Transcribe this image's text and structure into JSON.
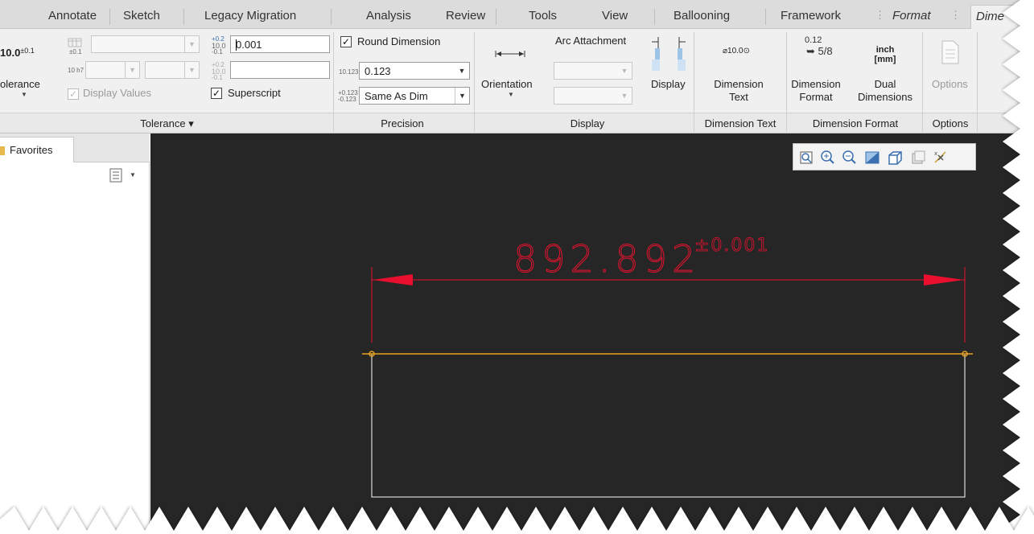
{
  "tabs": [
    "Annotate",
    "Sketch",
    "Legacy Migration",
    "Analysis",
    "Review",
    "Tools",
    "View",
    "Ballooning",
    "Framework",
    "Format",
    "Dime"
  ],
  "tolerance": {
    "tol_icon_text": "10.0",
    "tol_icon_sub": "±0.1",
    "tolerance_label": "olerance",
    "display_values_label": "Display Values",
    "upper_value": "0.001",
    "superscript_label": "Superscript",
    "group_label": "Tolerance ▾",
    "mini_labels": [
      "±0.1",
      "10 h7",
      "+0.2",
      "10.0",
      "-0.1"
    ]
  },
  "precision": {
    "round_dimension_label": "Round Dimension",
    "decimal_value": "0.123",
    "tolerance_decimal_value": "Same As Dim",
    "icon_decimal": "10.123",
    "icon_tol_upper": "+0.123",
    "icon_tol_lower": "-0.123",
    "group_label": "Precision"
  },
  "display": {
    "orientation_label": "Orientation",
    "arc_attachment_label": "Arc Attachment",
    "display_label": "Display",
    "group_label": "Display"
  },
  "dimension_text": {
    "icon_text": "⌀10.0⊙",
    "label_line1": "Dimension",
    "label_line2": "Text",
    "group_label": "Dimension Text"
  },
  "dimension_format": {
    "icon_decimal": "0.12",
    "icon_fraction": "5/8",
    "format_label_line1": "Dimension",
    "format_label_line2": "Format",
    "dual_icon_line1": "inch",
    "dual_icon_line2": "[mm]",
    "dual_label_line1": "Dual",
    "dual_label_line2": "Dimensions",
    "group_label": "Dimension Format"
  },
  "options": {
    "label": "Options",
    "group_label": "Options"
  },
  "left_panel": {
    "favorites_tab": "Favorites"
  },
  "drawing": {
    "dimension_value": "892.892",
    "tolerance_text": "±0.001",
    "dimension_color": "#e8102e",
    "line_color": "#e8a020",
    "rect_color": "#ffffff",
    "background_color": "#262626"
  },
  "view_toolbar": {
    "icons": [
      "zoom-window-icon",
      "zoom-in-icon",
      "zoom-out-icon",
      "refit-icon",
      "display-style-icon",
      "saved-views-icon",
      "annotation-display-icon"
    ]
  }
}
